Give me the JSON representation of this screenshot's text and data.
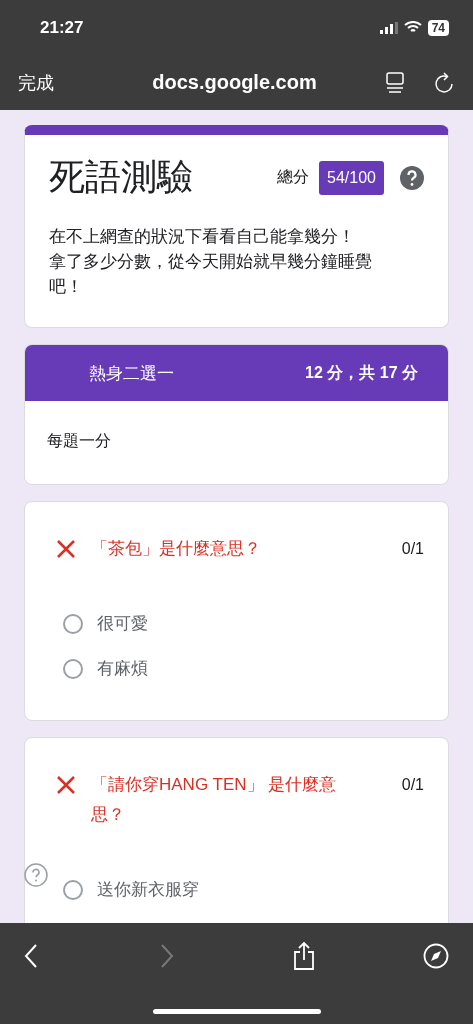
{
  "status_bar": {
    "time": "21:27",
    "battery": "74"
  },
  "browser_bar": {
    "done": "完成",
    "url": "docs.google.com"
  },
  "header": {
    "title": "死語測驗",
    "score_label": "總分",
    "score": "54/100",
    "description_lines": [
      "在不上網查的狀況下看看自己能拿幾分！",
      "拿了多少分數，從今天開始就早幾分鐘睡覺吧！"
    ]
  },
  "section": {
    "title": "熱身二選一",
    "score": "12 分，共 17 分",
    "description": "每題一分"
  },
  "questions": [
    {
      "text": "「茶包」是什麼意思？",
      "correct": false,
      "points": "0/1",
      "options": [
        {
          "label": "很可愛",
          "selected": false
        },
        {
          "label": "有麻煩",
          "selected": false
        }
      ]
    },
    {
      "text": "「請你穿HANG TEN」 是什麼意思？",
      "correct": false,
      "points": "0/1",
      "options": [
        {
          "label": "送你新衣服穿",
          "selected": false
        }
      ]
    }
  ],
  "toolbar": {
    "back_disabled": false,
    "forward_disabled": true
  }
}
